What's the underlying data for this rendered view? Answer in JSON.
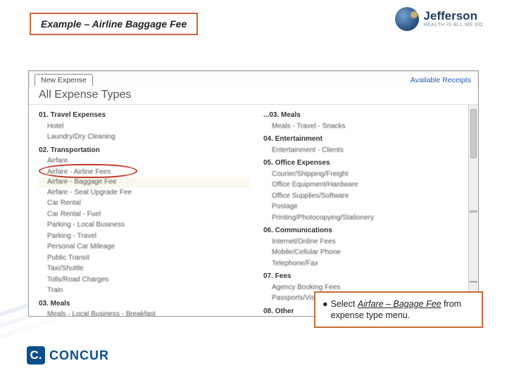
{
  "title_box": "Example – Airline Baggage Fee",
  "brand": {
    "name": "Jefferson",
    "tagline": "HEALTH IS ALL WE DO"
  },
  "panel": {
    "tab": "New Expense",
    "receipts_link": "Available Receipts",
    "heading": "All Expense Types",
    "left": {
      "g1": "01. Travel Expenses",
      "g1_items": [
        "Hotel",
        "Laundry/Dry Cleaning"
      ],
      "g2": "02. Transportation",
      "g2_items": [
        "Airfare",
        "Airfare - Airline Fees",
        "Airfare - Baggage Fee",
        "Airfare - Seat Upgrade Fee",
        "Car Rental",
        "Car Rental - Fuel",
        "Parking - Local Business",
        "Parking - Travel",
        "Personal Car Mileage",
        "Public Transit",
        "Taxi/Shuttle",
        "Tolls/Road Charges",
        "Train"
      ],
      "g3": "03. Meals",
      "g3_items": [
        "Meals - Local Business - Breakfast"
      ]
    },
    "right": {
      "g3b": "...03. Meals",
      "g3b_items": [
        "Meals - Travel - Snacks"
      ],
      "g4": "04. Entertainment",
      "g4_items": [
        "Entertainment - Clients"
      ],
      "g5": "05. Office Expenses",
      "g5_items": [
        "Courier/Shipping/Freight",
        "Office Equipment/Hardware",
        "Office Supplies/Software",
        "Postage",
        "Printing/Photocopying/Stationery"
      ],
      "g6": "06. Communications",
      "g6_items": [
        "Internet/Online Fees",
        "Mobile/Cellular Phone",
        "Telephone/Fax"
      ],
      "g7": "07. Fees",
      "g7_items": [
        "Agency Booking Fees",
        "Passports/Visa Fees"
      ],
      "g8": "08. Other"
    }
  },
  "callout": {
    "lead": "Select ",
    "emph": "Airfare – Bagage Fee",
    "tail": " from expense type menu."
  },
  "concur": {
    "mark": "C.",
    "word": "CONCUR"
  }
}
